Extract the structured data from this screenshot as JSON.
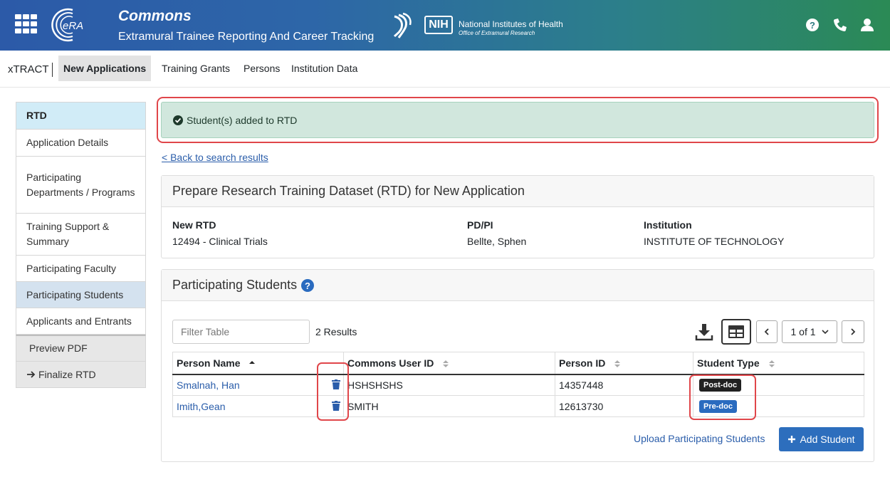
{
  "header": {
    "app_title": "Commons",
    "app_subtitle": "Extramural Trainee Reporting And Career Tracking",
    "era_logo_text": "eRA",
    "nih_abbrev": "NIH",
    "nih_name": "National Institutes of Health",
    "nih_office": "Office of Extramural Research",
    "icons": [
      "apps-grid-icon",
      "help-icon",
      "phone-icon",
      "user-icon"
    ]
  },
  "nav": {
    "brand": "xTRACT",
    "items": [
      "New Applications",
      "Training Grants",
      "Persons",
      "Institution Data"
    ],
    "active": "New Applications"
  },
  "sidebar": {
    "header": "RTD",
    "items": [
      "Application Details",
      "Participating Departments / Programs",
      "Training Support & Summary",
      "Participating Faculty",
      "Participating Students",
      "Applicants and Entrants"
    ],
    "active": "Participating Students",
    "actions": [
      "Preview PDF",
      "Finalize RTD"
    ]
  },
  "alert": {
    "text": "Student(s) added to RTD",
    "color": "#d1e7dd"
  },
  "back_link": "< Back to search results",
  "rtd_panel": {
    "title": "Prepare Research Training Dataset (RTD) for New Application",
    "fields": [
      {
        "label": "New RTD",
        "value": "12494 - Clinical Trials"
      },
      {
        "label": "PD/PI",
        "value": "Bellte, Sphen"
      },
      {
        "label": "Institution",
        "value": "INSTITUTE OF TECHNOLOGY"
      }
    ]
  },
  "students_panel": {
    "title": "Participating Students",
    "filter_placeholder": "Filter Table",
    "results": "2 Results",
    "page_select": "1 of 1",
    "columns": [
      "Person Name",
      "Commons User ID",
      "Person ID",
      "Student Type"
    ],
    "rows": [
      {
        "name": "Smalnah, Han",
        "commons_id": "HSHSHSHS",
        "person_id": "14357448",
        "type": "Post-doc",
        "type_color": "#212121"
      },
      {
        "name": "Imith,Gean",
        "commons_id": "SMITH",
        "person_id": "12613730",
        "type": "Pre-doc",
        "type_color": "#2a6bbf"
      }
    ],
    "upload_link": "Upload Participating Students",
    "add_button": "Add Student"
  },
  "colors": {
    "accent": "#2a5daa",
    "highlight_ring": "#e0464a"
  }
}
